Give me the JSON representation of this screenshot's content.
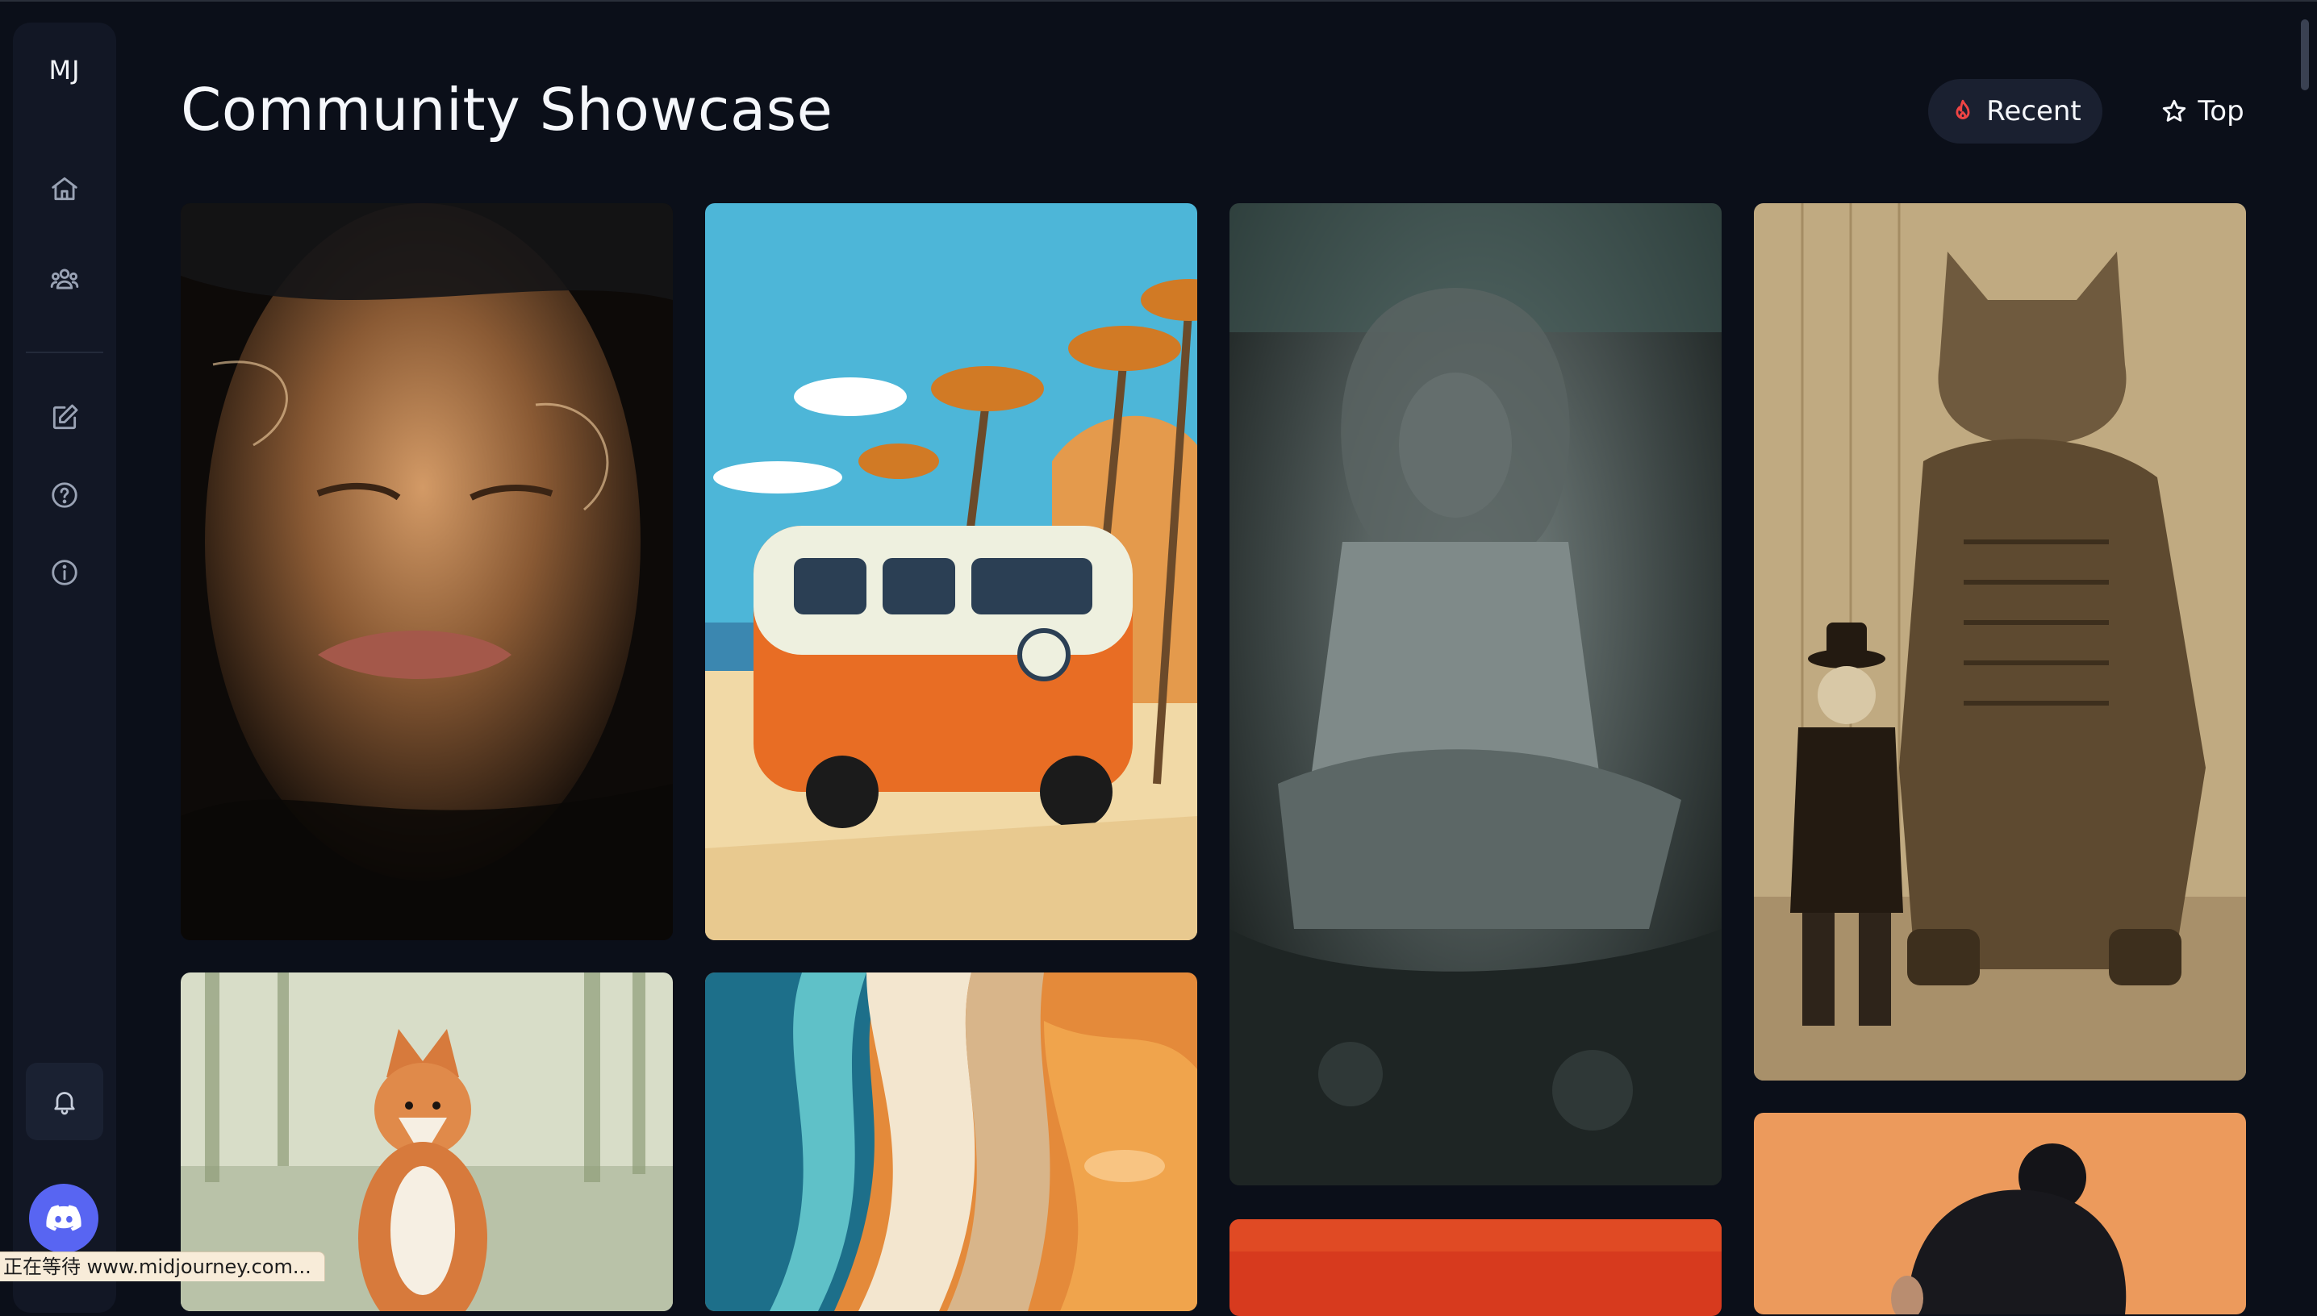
{
  "sidebar": {
    "logo": "MJ",
    "nav_items": [
      {
        "icon": "home-icon"
      },
      {
        "icon": "users-icon"
      },
      {
        "icon": "edit-icon"
      },
      {
        "icon": "help-icon"
      },
      {
        "icon": "info-icon"
      }
    ],
    "notification_icon": "bell-icon",
    "discord_icon": "discord-icon"
  },
  "header": {
    "title": "Community Showcase",
    "tabs": [
      {
        "label": "Recent",
        "icon": "flame-icon",
        "selected": true
      },
      {
        "label": "Top",
        "icon": "star-icon",
        "selected": false
      }
    ]
  },
  "gallery": {
    "images": [
      "woman-face-in-water",
      "orange-vw-van-under-palm-trees",
      "dark-fantasy-warrior-on-throne",
      "sepia-boy-with-mechanical-cat",
      "fox-in-misty-forest",
      "abstract-orange-blue-fluid",
      "red-image-partial",
      "woman-with-hair-bun-on-orange"
    ]
  },
  "status_bar": {
    "text": "正在等待 www.midjourney.com..."
  },
  "colors": {
    "background": "#0b0f19",
    "sidebar": "#121725",
    "selected_tab": "#1a2030",
    "flame": "#ef4444",
    "discord": "#5865f2"
  }
}
